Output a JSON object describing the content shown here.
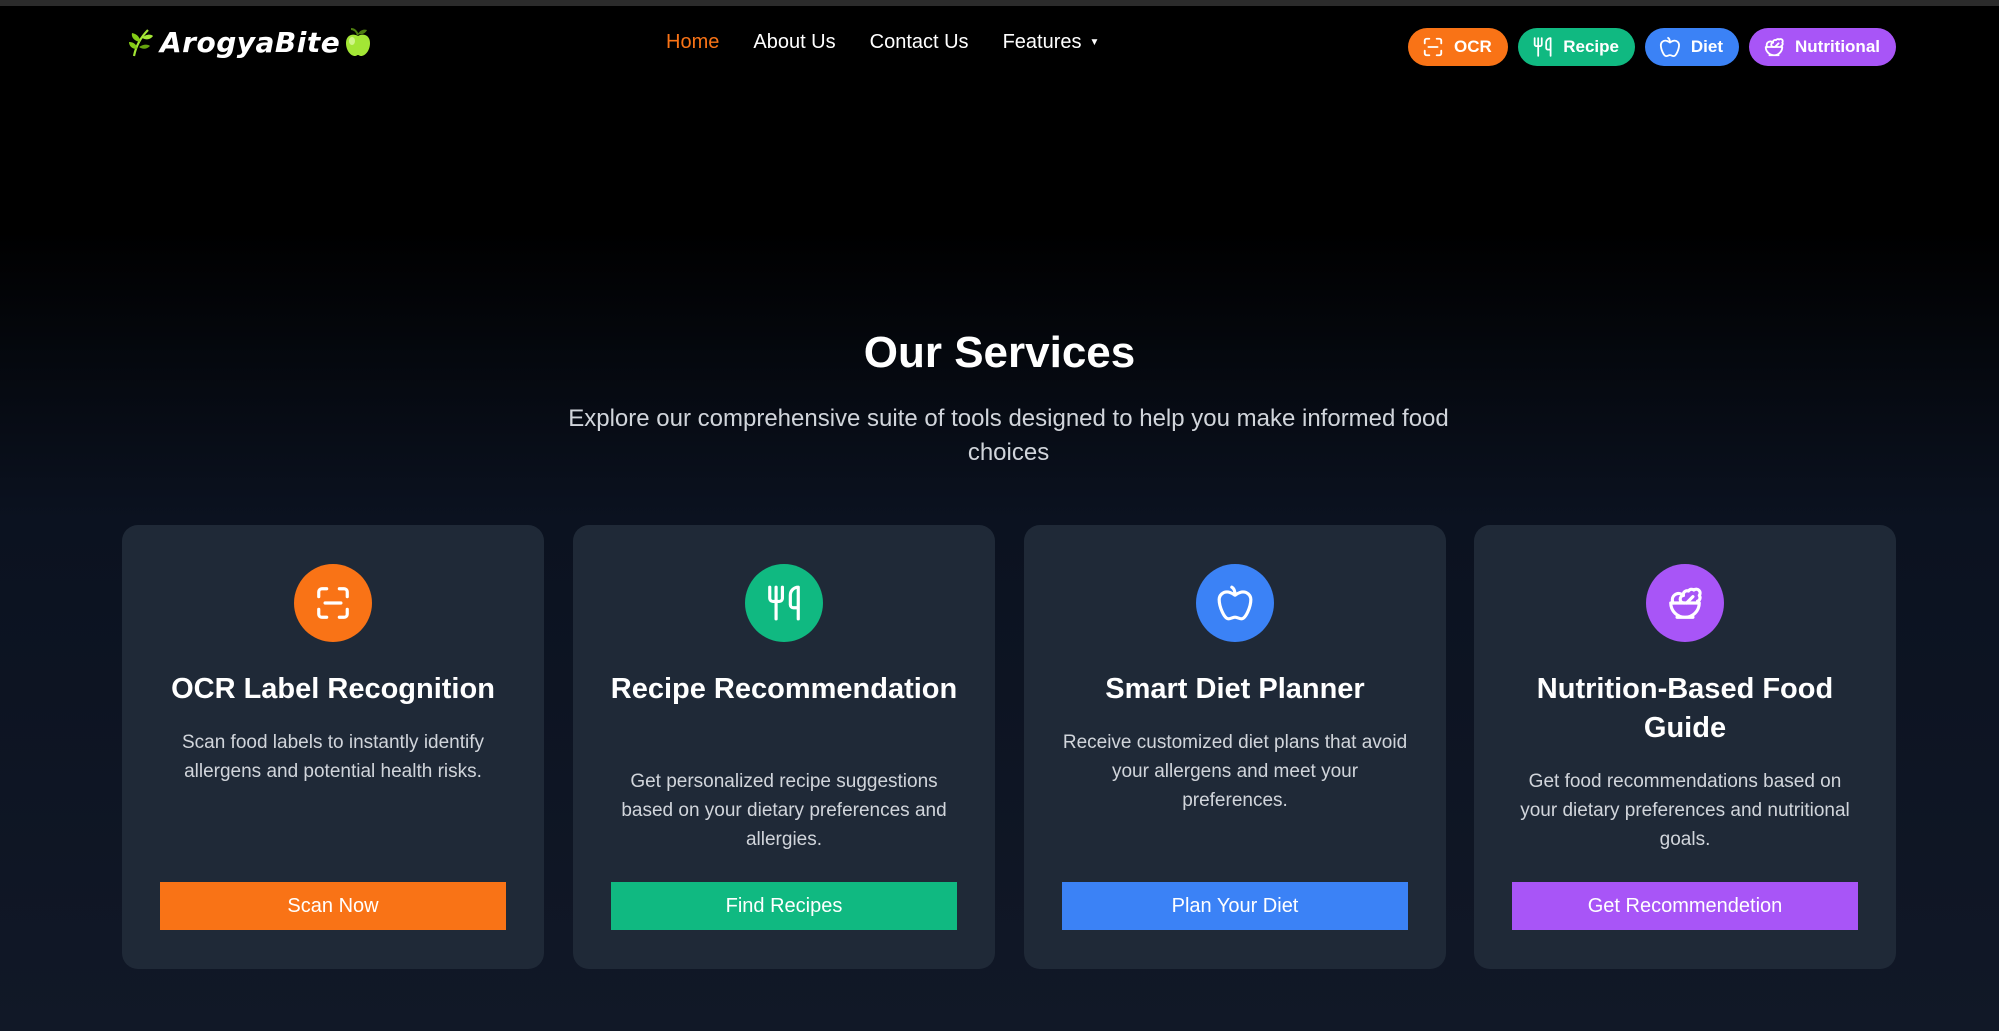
{
  "brand": {
    "name": "ArogyaBite",
    "leaf_icon": "leaf-icon",
    "apple_icon": "green-apple-icon"
  },
  "nav": {
    "links": [
      {
        "label": "Home",
        "active": true
      },
      {
        "label": "About Us",
        "active": false
      },
      {
        "label": "Contact Us",
        "active": false
      },
      {
        "label": "Features",
        "active": false,
        "caret": "▼"
      }
    ],
    "pills": [
      {
        "label": "OCR",
        "icon": "scan-icon",
        "color": "#f97316"
      },
      {
        "label": "Recipe",
        "icon": "utensils-icon",
        "color": "#10b981"
      },
      {
        "label": "Diet",
        "icon": "apple-icon",
        "color": "#3b82f6"
      },
      {
        "label": "Nutritional",
        "icon": "salad-icon",
        "color": "#a855f7"
      }
    ]
  },
  "services": {
    "title": "Our Services",
    "subtitle": "Explore our comprehensive suite of tools designed to help you make informed food choices",
    "cards": [
      {
        "title": "OCR Label Recognition",
        "description": "Scan food labels to instantly identify allergens and potential health risks.",
        "button": "Scan Now",
        "icon": "scan-icon",
        "color": "#f97316"
      },
      {
        "title": "Recipe Recommendation",
        "description": "Get personalized recipe suggestions based on your dietary preferences and allergies.",
        "button": "Find Recipes",
        "icon": "utensils-icon",
        "color": "#10b981"
      },
      {
        "title": "Smart Diet Planner",
        "description": "Receive customized diet plans that avoid your allergens and meet your preferences.",
        "button": "Plan Your Diet",
        "icon": "apple-icon",
        "color": "#3b82f6"
      },
      {
        "title": "Nutrition-Based Food Guide",
        "description": "Get food recommendations based on your dietary preferences and nutritional goals.",
        "button": "Get Recommendetion",
        "icon": "salad-icon",
        "color": "#a855f7"
      }
    ]
  },
  "colors": {
    "background": "#000000",
    "card": "#1f2937",
    "active_link": "#f97316",
    "muted_text": "#d1d5db"
  }
}
